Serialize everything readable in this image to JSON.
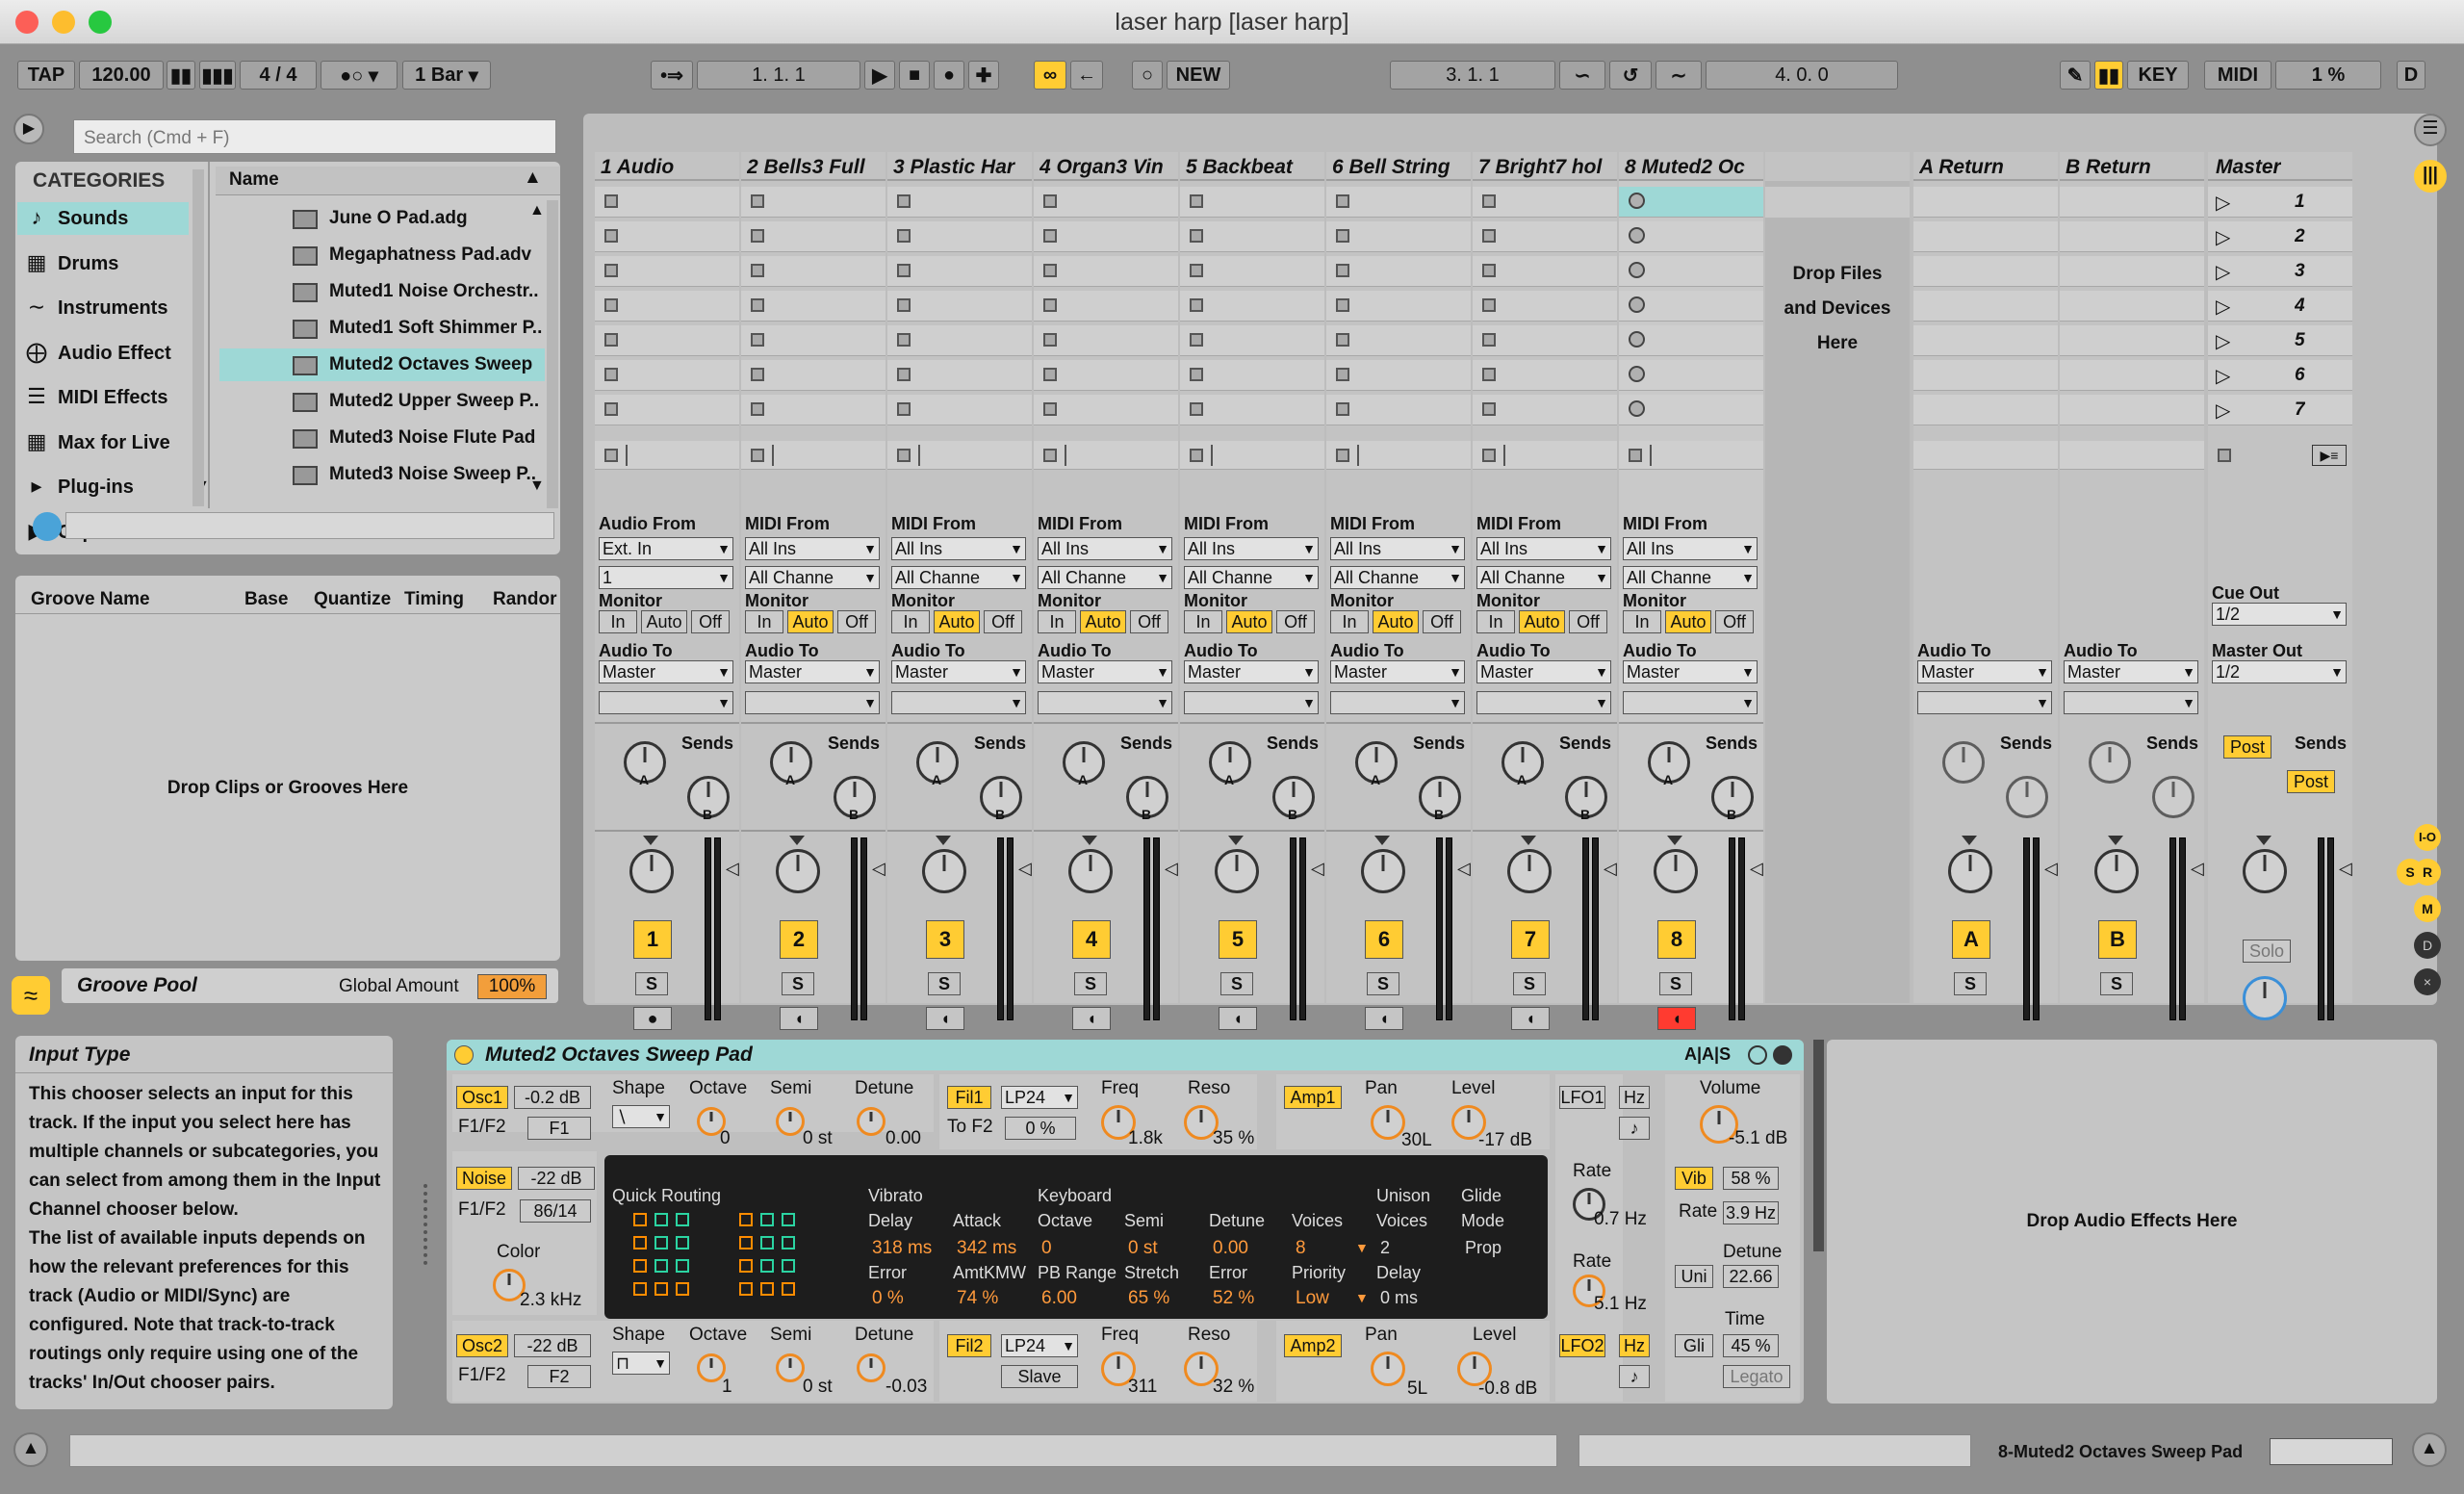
{
  "window": {
    "title": "laser harp  [laser harp]"
  },
  "transport": {
    "tap": "TAP",
    "tempo": "120.00",
    "sig": "4 / 4",
    "quant": "1 Bar",
    "pos": "1.   1.   1",
    "new": "NEW",
    "loop_start": "3.   1.   1",
    "loop_len": "4.   0.   0",
    "key": "KEY",
    "midi": "MIDI",
    "cpu": "1 %",
    "d": "D"
  },
  "browser": {
    "search_placeholder": "Search (Cmd + F)",
    "categories_header": "CATEGORIES",
    "name_header": "Name",
    "categories": [
      {
        "label": "Sounds",
        "icon": "note-icon"
      },
      {
        "label": "Drums",
        "icon": "grid-icon"
      },
      {
        "label": "Instruments",
        "icon": "wave-icon"
      },
      {
        "label": "Audio Effect",
        "icon": "fx-icon"
      },
      {
        "label": "MIDI Effects",
        "icon": "midi-fx-icon"
      },
      {
        "label": "Max for Live",
        "icon": "m4l-icon"
      },
      {
        "label": "Plug-ins",
        "icon": "plug-icon"
      },
      {
        "label": "Clips",
        "icon": "clip-icon"
      }
    ],
    "files": [
      "June O Pad.adg",
      "Megaphatness Pad.adv",
      "Muted1 Noise Orchestr..",
      "Muted1 Soft Shimmer P..",
      "Muted2 Octaves Sweep",
      "Muted2 Upper Sweep P..",
      "Muted3 Noise Flute Pad",
      "Muted3 Noise Sweep P.."
    ]
  },
  "groove": {
    "cols": [
      "Groove Name",
      "Base",
      "Quantize",
      "Timing",
      "Randor"
    ],
    "empty": "Drop Clips or Grooves Here",
    "title": "Groove Pool",
    "global_label": "Global Amount",
    "global_value": "100%"
  },
  "tracks": [
    {
      "name": "1 Audio",
      "num": "1",
      "from_label": "Audio From",
      "from": "Ext. In",
      "chan": "1",
      "in": "In",
      "auto": "Auto",
      "off": "Off",
      "to": "Master"
    },
    {
      "name": "2 Bells3 Full",
      "num": "2",
      "from_label": "MIDI From",
      "from": "All Ins",
      "chan": "All Channe",
      "in": "In",
      "auto": "Auto",
      "off": "Off",
      "to": "Master"
    },
    {
      "name": "3 Plastic Har",
      "num": "3",
      "from_label": "MIDI From",
      "from": "All Ins",
      "chan": "All Channe",
      "in": "In",
      "auto": "Auto",
      "off": "Off",
      "to": "Master"
    },
    {
      "name": "4 Organ3 Vin",
      "num": "4",
      "from_label": "MIDI From",
      "from": "All Ins",
      "chan": "All Channe",
      "in": "In",
      "auto": "Auto",
      "off": "Off",
      "to": "Master"
    },
    {
      "name": "5 Backbeat",
      "num": "5",
      "from_label": "MIDI From",
      "from": "All Ins",
      "chan": "All Channe",
      "in": "In",
      "auto": "Auto",
      "off": "Off",
      "to": "Master"
    },
    {
      "name": "6 Bell String",
      "num": "6",
      "from_label": "MIDI From",
      "from": "All Ins",
      "chan": "All Channe",
      "in": "In",
      "auto": "Auto",
      "off": "Off",
      "to": "Master"
    },
    {
      "name": "7 Bright7 hol",
      "num": "7",
      "from_label": "MIDI From",
      "from": "All Ins",
      "chan": "All Channe",
      "in": "In",
      "auto": "Auto",
      "off": "Off",
      "to": "Master"
    },
    {
      "name": "8 Muted2 Oc",
      "num": "8",
      "from_label": "MIDI From",
      "from": "All Ins",
      "chan": "All Channe",
      "in": "In",
      "auto": "Auto",
      "off": "Off",
      "to": "Master"
    }
  ],
  "mixer": {
    "monitor": "Monitor",
    "audio_to": "Audio To",
    "sends": "Sends",
    "s": "S",
    "a": "A",
    "b_letter": "B",
    "drop_files": [
      "Drop Files",
      "and Devices",
      "Here"
    ]
  },
  "returns": [
    {
      "name": "A Return",
      "letter": "A",
      "to": "Master"
    },
    {
      "name": "B Return",
      "letter": "B",
      "to": "Master"
    }
  ],
  "master": {
    "name": "Master",
    "scenes": [
      "1",
      "2",
      "3",
      "4",
      "5",
      "6",
      "7"
    ],
    "cue_out_label": "Cue Out",
    "cue_out": "1/2",
    "master_out_label": "Master Out",
    "master_out": "1/2",
    "post": "Post",
    "solo": "Solo"
  },
  "info": {
    "title": "Input Type",
    "text": "This chooser selects an input for this track. If the input you select here has multiple channels or subcategories, you can select from among them in the Input Channel chooser below.\nThe list of available inputs depends on how the relevant preferences for this track (Audio or MIDI/Sync) are configured. Note that track-to-track routings only require using one of the tracks' In/Out chooser pairs."
  },
  "device": {
    "title": "Muted2 Octaves Sweep Pad",
    "osc1": {
      "btn": "Osc1",
      "level": "-0.2 dB",
      "f1f2": "F1/F2",
      "f": "F1",
      "shape": "Shape",
      "octave": "Octave",
      "oct_v": "0",
      "semi": "Semi",
      "semi_v": "0 st",
      "detune": "Detune",
      "detune_v": "0.00"
    },
    "noise": {
      "btn": "Noise",
      "level": "-22 dB",
      "f1f2": "F1/F2",
      "f": "86/14",
      "color": "Color",
      "color_v": "2.3 kHz"
    },
    "osc2": {
      "btn": "Osc2",
      "level": "-22 dB",
      "f1f2": "F1/F2",
      "f": "F2",
      "shape": "Shape",
      "octave": "Octave",
      "oct_v": "1",
      "semi": "Semi",
      "semi_v": "0 st",
      "detune": "Detune",
      "detune_v": "-0.03"
    },
    "fil1": {
      "btn": "Fil1",
      "type": "LP24",
      "tof2": "To F2",
      "tof2_v": "0 %",
      "freq": "Freq",
      "freq_v": "1.8k",
      "reso": "Reso",
      "reso_v": "35 %"
    },
    "fil2": {
      "btn": "Fil2",
      "type": "LP24",
      "slave": "Slave",
      "freq": "Freq",
      "freq_v": "311",
      "reso": "Reso",
      "reso_v": "32 %"
    },
    "amp1": {
      "btn": "Amp1",
      "pan": "Pan",
      "pan_v": "30L",
      "level": "Level",
      "level_v": "-17 dB"
    },
    "amp2": {
      "btn": "Amp2",
      "pan": "Pan",
      "pan_v": "5L",
      "level": "Level",
      "level_v": "-0.8 dB"
    },
    "lfo1": {
      "btn": "LFO1",
      "hz": "Hz",
      "rate": "Rate",
      "rate_v": "0.7 Hz"
    },
    "lfo2": {
      "btn": "LFO2",
      "hz": "Hz",
      "rate": "Rate",
      "rate_v": "5.1 Hz"
    },
    "global": {
      "volume": "Volume",
      "volume_v": "-5.1 dB",
      "vib": "Vib",
      "vib_v": "58 %",
      "rate": "Rate",
      "rate_v": "3.9 Hz",
      "uni": "Uni",
      "detune": "Detune",
      "detune_v": "22.66",
      "gli": "Gli",
      "time": "Time",
      "time_v": "45 %",
      "legato": "Legato"
    },
    "center": {
      "qr": "Quick Routing",
      "vibrato": "Vibrato",
      "delay": "Delay",
      "delay_v": "318 ms",
      "error": "Error",
      "error_v": "0 %",
      "attack": "Attack",
      "attack_v": "342 ms",
      "amtkmw": "AmtKMW",
      "amtkmw_v": "74 %",
      "keyboard": "Keyboard",
      "octave": "Octave",
      "octave_v": "0",
      "pbrange": "PB Range",
      "pbrange_v": "6.00",
      "semi": "Semi",
      "semi_v": "0 st",
      "stretch": "Stretch",
      "stretch_v": "65 %",
      "detune": "Detune",
      "detune_v": "0.00",
      "kerror": "Error",
      "kerror_v": "52 %",
      "voices": "Voices",
      "voices_v": "8",
      "priority": "Priority",
      "priority_v": "Low",
      "unison": "Unison",
      "uvoices": "Voices",
      "uvoices_v": "2",
      "udelay": "Delay",
      "udelay_v": "0 ms",
      "glide": "Glide",
      "mode": "Mode",
      "mode_v": "Prop"
    }
  },
  "drop_fx": "Drop Audio Effects Here",
  "status": {
    "track": "8-Muted2 Octaves Sweep Pad"
  },
  "colors": {
    "accent": "#ffcc33",
    "orange": "#f29e3b",
    "teal": "#9ed8d6",
    "red": "#ff3b30"
  }
}
